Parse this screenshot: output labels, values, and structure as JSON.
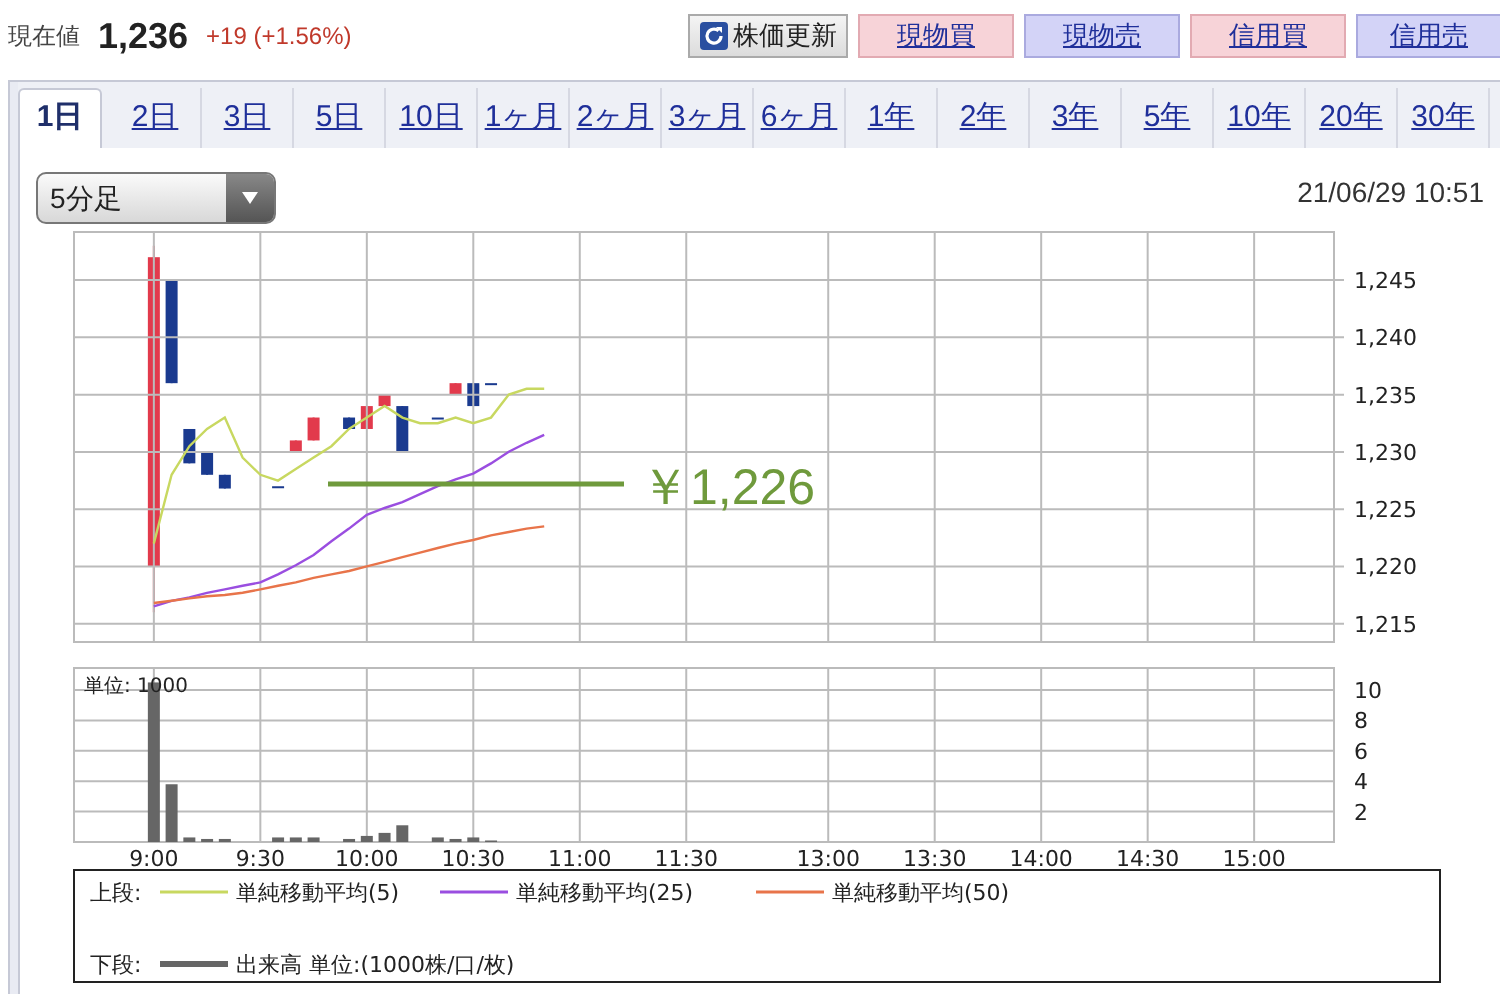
{
  "quote": {
    "label": "現在値",
    "price": "1,236",
    "change": "+19 (+1.56%)"
  },
  "buttons": [
    {
      "label": "株価更新",
      "kind": "refresh"
    },
    {
      "label": "現物買",
      "kind": "buy"
    },
    {
      "label": "現物売",
      "kind": "sell"
    },
    {
      "label": "信用買",
      "kind": "buy"
    },
    {
      "label": "信用売",
      "kind": "sell"
    }
  ],
  "tabs": [
    {
      "label": "1日",
      "selected": true
    },
    {
      "label": "2日",
      "selected": false
    },
    {
      "label": "3日",
      "selected": false
    },
    {
      "label": "5日",
      "selected": false
    },
    {
      "label": "10日",
      "selected": false
    },
    {
      "label": "1ヶ月",
      "selected": false
    },
    {
      "label": "2ヶ月",
      "selected": false
    },
    {
      "label": "3ヶ月",
      "selected": false
    },
    {
      "label": "6ヶ月",
      "selected": false
    },
    {
      "label": "1年",
      "selected": false
    },
    {
      "label": "2年",
      "selected": false
    },
    {
      "label": "3年",
      "selected": false
    },
    {
      "label": "5年",
      "selected": false
    },
    {
      "label": "10年",
      "selected": false
    },
    {
      "label": "20年",
      "selected": false
    },
    {
      "label": "30年",
      "selected": false
    }
  ],
  "interval_select": {
    "value": "5分足"
  },
  "timestamp": "21/06/29 10:51",
  "price_chart": {
    "chart_data": {
      "type": "line",
      "grid": true,
      "categories": [
        null,
        null,
        null,
        null,
        null,
        null,
        null,
        null,
        null,
        null,
        null,
        null,
        null,
        null,
        null,
        null,
        null,
        null,
        null,
        null,
        null,
        null,
        null,
        null,
        null,
        null,
        null,
        null,
        null,
        null,
        null,
        null,
        null,
        null,
        null,
        null,
        null,
        null,
        null,
        null,
        null,
        null,
        null,
        null,
        null,
        null,
        null,
        null,
        null,
        null,
        null,
        null,
        null,
        null,
        null,
        null,
        null,
        null,
        null,
        null,
        null,
        null,
        null,
        null,
        null,
        null,
        null,
        null,
        null,
        null,
        null
      ],
      "series": [
        {
          "name": "単純移動平均(5)",
          "color": "#c8d860",
          "values": [
            null,
            null,
            null,
            null,
            1222,
            1228,
            1230.5,
            1232,
            1233,
            1229.5,
            1228,
            1227.5,
            1228.5,
            1229.5,
            1230.5,
            1232,
            1233,
            1234,
            1233,
            1232.5,
            1232.5,
            1233,
            1232.5,
            1233,
            1235,
            1235.5,
            1235.5,
            null,
            null,
            null,
            null,
            null,
            null,
            null,
            null,
            null,
            null,
            null,
            null,
            null,
            null,
            null,
            null,
            null,
            null,
            null,
            null,
            null,
            null,
            null,
            null,
            null,
            null,
            null,
            null,
            null,
            null,
            null,
            null,
            null,
            null,
            null,
            null,
            null,
            null,
            null,
            null,
            null,
            null,
            null,
            null
          ]
        },
        {
          "name": "単純移動平均(25)",
          "color": "#9a4ee0",
          "values": [
            null,
            null,
            null,
            null,
            1216.5,
            1217,
            1217.3,
            1217.7,
            1218,
            1218.3,
            1218.6,
            1219.3,
            1220.1,
            1221,
            1222.2,
            1223.3,
            1224.5,
            1225.1,
            1225.6,
            1226.3,
            1227,
            1227.6,
            1228.1,
            1229,
            1230,
            1230.8,
            1231.5,
            null,
            null,
            null,
            null,
            null,
            null,
            null,
            null,
            null,
            null,
            null,
            null,
            null,
            null,
            null,
            null,
            null,
            null,
            null,
            null,
            null,
            null,
            null,
            null,
            null,
            null,
            null,
            null,
            null,
            null,
            null,
            null,
            null,
            null,
            null,
            null,
            null,
            null,
            null,
            null,
            null,
            null,
            null,
            null
          ]
        },
        {
          "name": "単純移動平均(50)",
          "color": "#e8744a",
          "values": [
            null,
            null,
            null,
            null,
            1216.8,
            1217,
            1217.2,
            1217.4,
            1217.5,
            1217.7,
            1218,
            1218.3,
            1218.6,
            1219,
            1219.3,
            1219.6,
            1220,
            1220.4,
            1220.8,
            1221.2,
            1221.6,
            1222,
            1222.3,
            1222.7,
            1223,
            1223.3,
            1223.5,
            null,
            null,
            null,
            null,
            null,
            null,
            null,
            null,
            null,
            null,
            null,
            null,
            null,
            null,
            null,
            null,
            null,
            null,
            null,
            null,
            null,
            null,
            null,
            null,
            null,
            null,
            null,
            null,
            null,
            null,
            null,
            null,
            null,
            null,
            null,
            null,
            null,
            null,
            null,
            null,
            null,
            null,
            null,
            null
          ]
        }
      ],
      "ylim": [
        1213.4,
        1249.2
      ],
      "yticks": [
        {
          "value": 1215,
          "label": "1,215"
        },
        {
          "value": 1220,
          "label": "1,220"
        },
        {
          "value": 1225,
          "label": "1,225"
        },
        {
          "value": 1230,
          "label": "1,230"
        },
        {
          "value": 1235,
          "label": "1,235"
        },
        {
          "value": 1240,
          "label": "1,240"
        },
        {
          "value": 1245,
          "label": "1,245"
        }
      ],
      "annotations": [
        "￥1,226"
      ]
    }
  },
  "volume_chart": {
    "chart_data": {
      "type": "bar",
      "grid": true,
      "ylabel": "単位: 1000",
      "categories": [
        null,
        null,
        null,
        null,
        "9:00",
        null,
        null,
        null,
        null,
        null,
        "9:30",
        null,
        null,
        null,
        null,
        null,
        "10:00",
        null,
        null,
        null,
        null,
        null,
        "10:30",
        null,
        null,
        null,
        null,
        null,
        "11:00",
        null,
        null,
        null,
        null,
        null,
        "11:30",
        null,
        null,
        null,
        null,
        null,
        null,
        null,
        "13:00",
        null,
        null,
        null,
        null,
        null,
        "13:30",
        null,
        null,
        null,
        null,
        null,
        "14:00",
        null,
        null,
        null,
        null,
        null,
        "14:30",
        null,
        null,
        null,
        null,
        null,
        "15:00",
        null,
        null,
        null,
        null
      ],
      "series": [
        {
          "name": "出来高 単位:(1000株/口/枚)",
          "color": "#666666",
          "values": [
            null,
            null,
            null,
            null,
            10.5,
            3.8,
            0.3,
            0.2,
            0.2,
            null,
            null,
            0.3,
            0.3,
            0.3,
            null,
            0.2,
            0.4,
            0.6,
            1.1,
            null,
            0.3,
            0.2,
            0.3,
            0.1,
            null,
            null,
            null,
            null,
            null,
            null,
            null,
            null,
            null,
            null,
            null,
            null,
            null,
            null,
            null,
            null,
            null,
            null,
            null,
            null,
            null,
            null,
            null,
            null,
            null,
            null,
            null,
            null,
            null,
            null,
            null,
            null,
            null,
            null,
            null,
            null,
            null,
            null,
            null,
            null,
            null,
            null,
            null,
            null,
            null,
            null,
            null
          ]
        }
      ],
      "ylim": [
        0,
        11.45
      ],
      "yticks": [
        2,
        4,
        6,
        8,
        10
      ]
    }
  },
  "legend": {
    "upper_label": "上段:",
    "lower_label": "下段:"
  }
}
